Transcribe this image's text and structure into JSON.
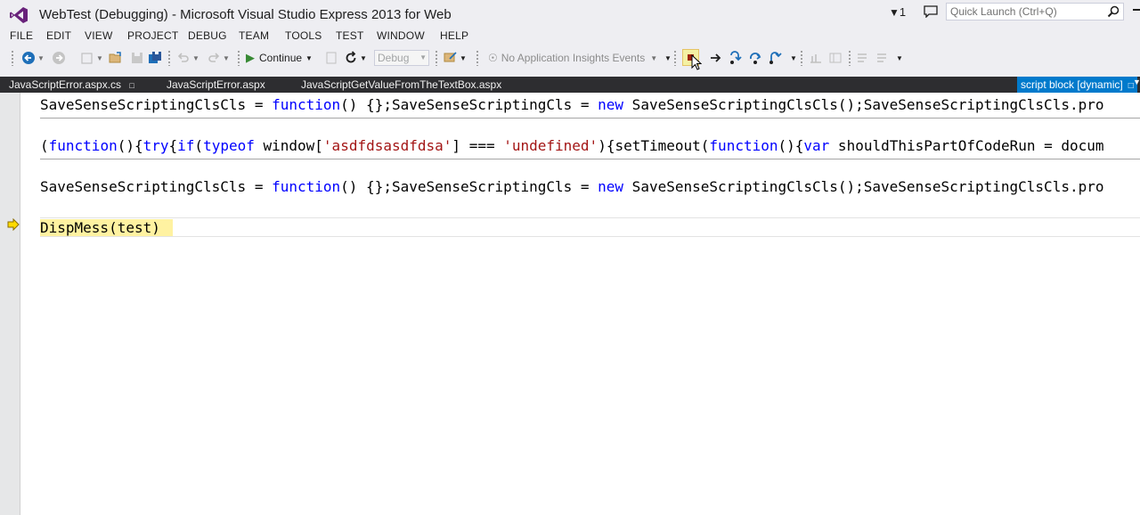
{
  "window": {
    "title": "WebTest (Debugging) - Microsoft Visual Studio Express 2013 for Web",
    "notification_count": "1",
    "quick_launch_placeholder": "Quick Launch (Ctrl+Q)"
  },
  "menu": [
    "FILE",
    "EDIT",
    "VIEW",
    "PROJECT",
    "DEBUG",
    "TEAM",
    "TOOLS",
    "TEST",
    "WINDOW",
    "HELP"
  ],
  "toolbar": {
    "continue_label": "Continue",
    "config_value": "Debug",
    "insights_label": "No Application Insights Events"
  },
  "tabs": [
    {
      "label": "JavaScriptError.aspx.cs"
    },
    {
      "label": "JavaScriptError.aspx"
    },
    {
      "label": "JavaScriptGetValueFromTheTextBox.aspx"
    }
  ],
  "active_tab": {
    "label": "script block [dynamic]"
  },
  "code": {
    "line1": {
      "a": "SaveSenseScriptingClsCls = ",
      "b": "function",
      "c": "() {};SaveSenseScriptingCls = ",
      "d": "new",
      "e": " SaveSenseScriptingClsCls();SaveSenseScriptingClsCls.pro"
    },
    "line2": {
      "a": "(",
      "b": "function",
      "c": "(){",
      "d": "try",
      "e": "{",
      "f": "if",
      "g": "(",
      "h": "typeof",
      "i": " window[",
      "j": "'asdfdsasdfdsa'",
      "k": "] === ",
      "l": "'undefined'",
      "m": "){setTimeout(",
      "n": "function",
      "o": "(){",
      "p": "var",
      "q": " shouldThisPartOfCodeRun = docum"
    },
    "line3": {
      "a": "SaveSenseScriptingClsCls = ",
      "b": "function",
      "c": "() {};SaveSenseScriptingCls = ",
      "d": "new",
      "e": " SaveSenseScriptingClsCls();SaveSenseScriptingClsCls.pro"
    },
    "current_line": "DispMess(test)"
  },
  "colors": {
    "accent": "#007acc",
    "keyword": "#0000ff",
    "string": "#a31515",
    "current_statement": "#fff2a1",
    "vs_purple": "#68217a"
  }
}
